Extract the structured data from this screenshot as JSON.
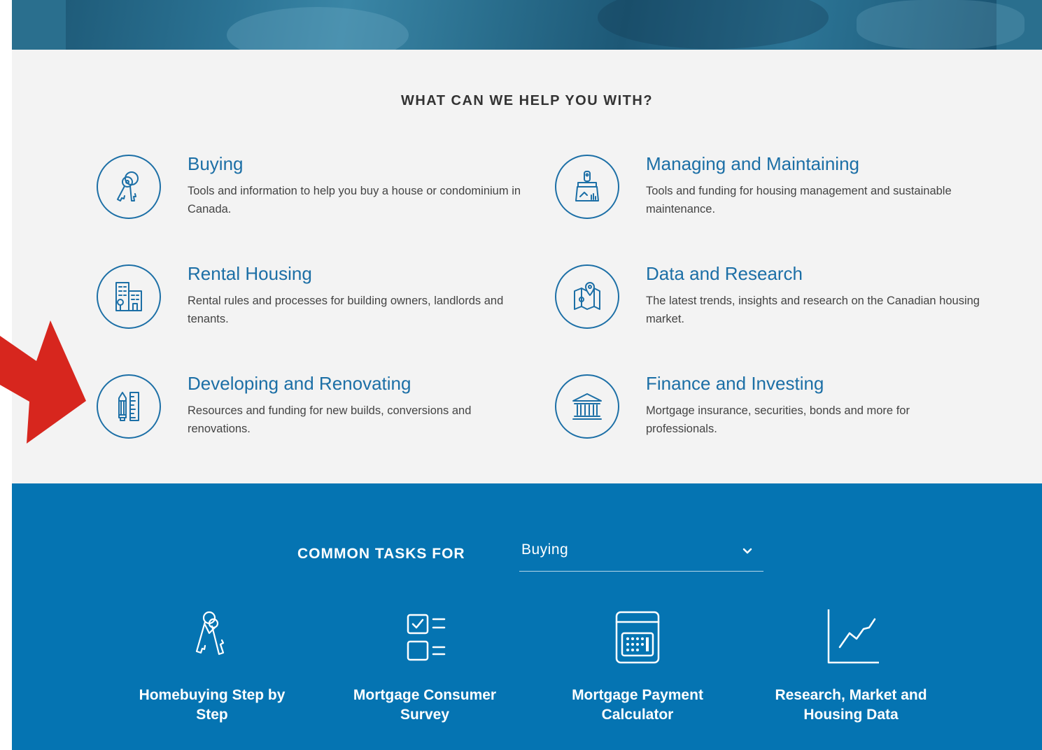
{
  "help": {
    "title": "WHAT CAN WE HELP YOU WITH?",
    "items": [
      {
        "title": "Buying",
        "desc": "Tools and information to help you buy a house or condominium in Canada.",
        "icon": "keys-icon"
      },
      {
        "title": "Managing and Maintaining",
        "desc": "Tools and funding for housing management and sustainable maintenance.",
        "icon": "paint-brush-icon"
      },
      {
        "title": "Rental Housing",
        "desc": "Rental rules and processes for building owners, landlords and tenants.",
        "icon": "buildings-icon"
      },
      {
        "title": "Data and Research",
        "desc": "The latest trends, insights and research on the Canadian housing market.",
        "icon": "map-pin-icon"
      },
      {
        "title": "Developing and Renovating",
        "desc": "Resources and funding for new builds, conversions and renovations.",
        "icon": "pencil-ruler-icon"
      },
      {
        "title": "Finance and Investing",
        "desc": "Mortgage insurance, securities, bonds and more for professionals.",
        "icon": "bank-icon"
      }
    ]
  },
  "tasks": {
    "label": "COMMON TASKS FOR",
    "selected": "Buying",
    "items": [
      {
        "label": "Homebuying Step by Step",
        "icon": "keys-icon"
      },
      {
        "label": "Mortgage Consumer Survey",
        "icon": "checklist-icon"
      },
      {
        "label": "Mortgage Payment Calculator",
        "icon": "calculator-icon"
      },
      {
        "label": "Research, Market and Housing Data",
        "icon": "line-chart-icon"
      }
    ]
  },
  "colors": {
    "accent": "#1c6fa6",
    "tasks_bg": "#0574b2",
    "help_bg": "#f3f3f3",
    "arrow": "#d7261e"
  }
}
